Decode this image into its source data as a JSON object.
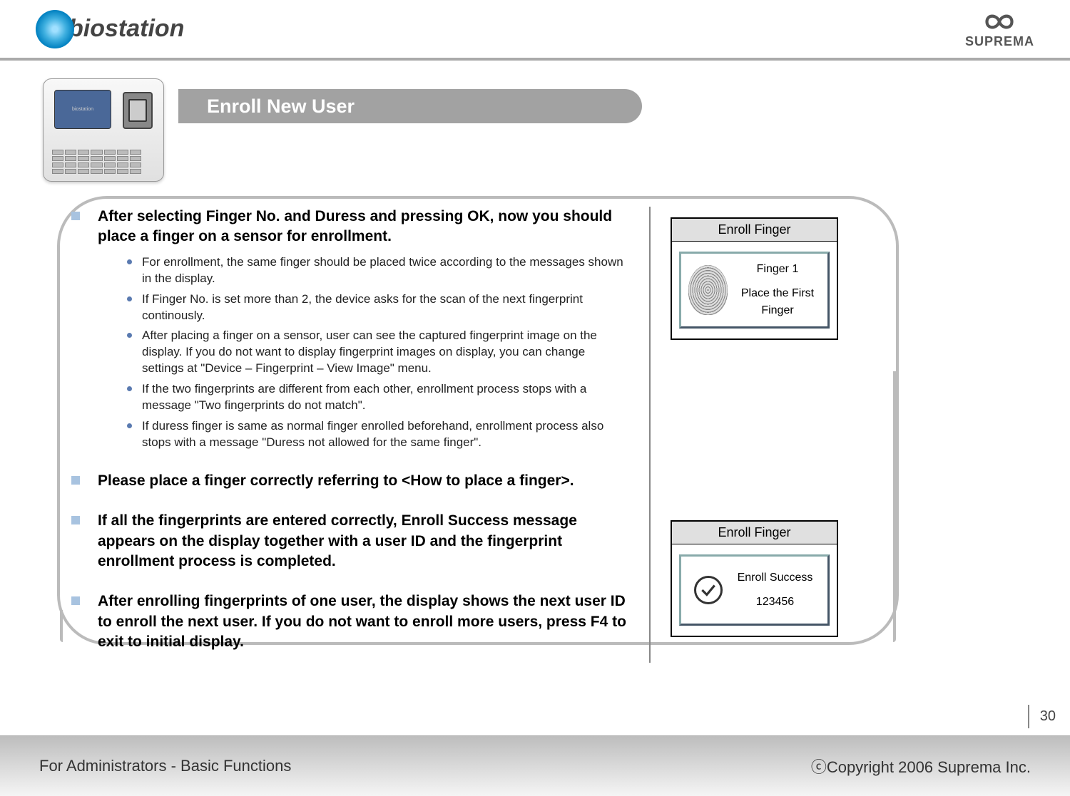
{
  "header": {
    "logo_left_text": "biostation",
    "logo_right_text": "SUPREMA"
  },
  "title": "Enroll New User",
  "bullets": [
    {
      "text": "After selecting Finger No. and Duress and pressing OK, now you should place a finger on a sensor for enrollment.",
      "subs": [
        "For enrollment, the same finger should be placed twice according to the messages shown in the display.",
        "If Finger No. is set more than 2, the device asks for the scan of the next fingerprint continously.",
        "After placing a finger on a sensor, user can see the captured fingerprint image on the display. If you do not want to display fingerprint images on display, you can change settings at \"Device – Fingerprint – View Image\" menu.",
        "If the two fingerprints are different from each other, enrollment process stops with a message \"Two fingerprints do not match\".",
        "If duress finger is same as normal finger enrolled beforehand, enrollment process also stops with a message \"Duress not allowed for the same finger\"."
      ]
    },
    {
      "text": "Please place a finger correctly referring to <How to place a finger>.",
      "subs": []
    },
    {
      "text": "If all the fingerprints are entered correctly, Enroll Success message appears on the display together with a user ID and the fingerprint enrollment process is completed.",
      "subs": []
    },
    {
      "text": "After enrolling fingerprints of one user, the display shows the next user ID to enroll the next user. If you do not want to enroll more users, press F4 to exit to initial display.",
      "subs": []
    }
  ],
  "panel1": {
    "title": "Enroll Finger",
    "line1": "Finger 1",
    "line2": "Place the First Finger"
  },
  "panel2": {
    "title": "Enroll Finger",
    "line1": "Enroll Success",
    "line2": "123456"
  },
  "footer": {
    "left": "For Administrators - Basic Functions",
    "right": "ⓒCopyright 2006 Suprema Inc."
  },
  "page_number": "30"
}
